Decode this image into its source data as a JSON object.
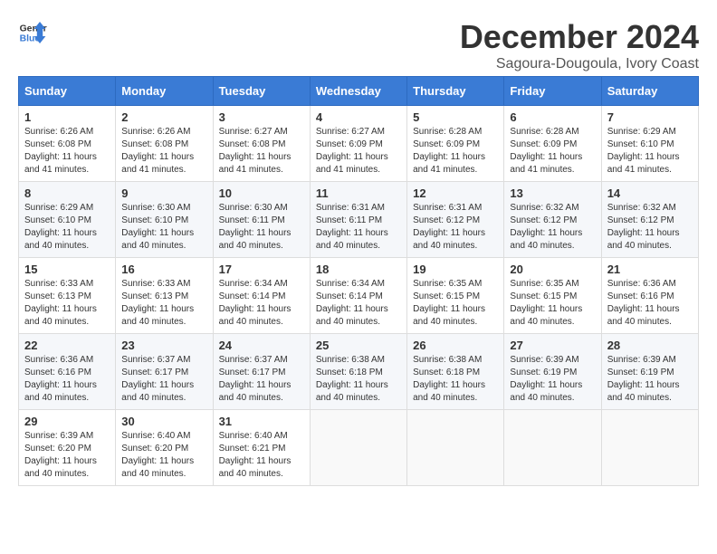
{
  "logo": {
    "line1": "General",
    "line2": "Blue"
  },
  "title": "December 2024",
  "subtitle": "Sagoura-Dougoula, Ivory Coast",
  "days": [
    "Sunday",
    "Monday",
    "Tuesday",
    "Wednesday",
    "Thursday",
    "Friday",
    "Saturday"
  ],
  "weeks": [
    [
      {
        "day": "1",
        "sunrise": "6:26 AM",
        "sunset": "6:08 PM",
        "daylight": "11 hours and 41 minutes."
      },
      {
        "day": "2",
        "sunrise": "6:26 AM",
        "sunset": "6:08 PM",
        "daylight": "11 hours and 41 minutes."
      },
      {
        "day": "3",
        "sunrise": "6:27 AM",
        "sunset": "6:08 PM",
        "daylight": "11 hours and 41 minutes."
      },
      {
        "day": "4",
        "sunrise": "6:27 AM",
        "sunset": "6:09 PM",
        "daylight": "11 hours and 41 minutes."
      },
      {
        "day": "5",
        "sunrise": "6:28 AM",
        "sunset": "6:09 PM",
        "daylight": "11 hours and 41 minutes."
      },
      {
        "day": "6",
        "sunrise": "6:28 AM",
        "sunset": "6:09 PM",
        "daylight": "11 hours and 41 minutes."
      },
      {
        "day": "7",
        "sunrise": "6:29 AM",
        "sunset": "6:10 PM",
        "daylight": "11 hours and 41 minutes."
      }
    ],
    [
      {
        "day": "8",
        "sunrise": "6:29 AM",
        "sunset": "6:10 PM",
        "daylight": "11 hours and 40 minutes."
      },
      {
        "day": "9",
        "sunrise": "6:30 AM",
        "sunset": "6:10 PM",
        "daylight": "11 hours and 40 minutes."
      },
      {
        "day": "10",
        "sunrise": "6:30 AM",
        "sunset": "6:11 PM",
        "daylight": "11 hours and 40 minutes."
      },
      {
        "day": "11",
        "sunrise": "6:31 AM",
        "sunset": "6:11 PM",
        "daylight": "11 hours and 40 minutes."
      },
      {
        "day": "12",
        "sunrise": "6:31 AM",
        "sunset": "6:12 PM",
        "daylight": "11 hours and 40 minutes."
      },
      {
        "day": "13",
        "sunrise": "6:32 AM",
        "sunset": "6:12 PM",
        "daylight": "11 hours and 40 minutes."
      },
      {
        "day": "14",
        "sunrise": "6:32 AM",
        "sunset": "6:12 PM",
        "daylight": "11 hours and 40 minutes."
      }
    ],
    [
      {
        "day": "15",
        "sunrise": "6:33 AM",
        "sunset": "6:13 PM",
        "daylight": "11 hours and 40 minutes."
      },
      {
        "day": "16",
        "sunrise": "6:33 AM",
        "sunset": "6:13 PM",
        "daylight": "11 hours and 40 minutes."
      },
      {
        "day": "17",
        "sunrise": "6:34 AM",
        "sunset": "6:14 PM",
        "daylight": "11 hours and 40 minutes."
      },
      {
        "day": "18",
        "sunrise": "6:34 AM",
        "sunset": "6:14 PM",
        "daylight": "11 hours and 40 minutes."
      },
      {
        "day": "19",
        "sunrise": "6:35 AM",
        "sunset": "6:15 PM",
        "daylight": "11 hours and 40 minutes."
      },
      {
        "day": "20",
        "sunrise": "6:35 AM",
        "sunset": "6:15 PM",
        "daylight": "11 hours and 40 minutes."
      },
      {
        "day": "21",
        "sunrise": "6:36 AM",
        "sunset": "6:16 PM",
        "daylight": "11 hours and 40 minutes."
      }
    ],
    [
      {
        "day": "22",
        "sunrise": "6:36 AM",
        "sunset": "6:16 PM",
        "daylight": "11 hours and 40 minutes."
      },
      {
        "day": "23",
        "sunrise": "6:37 AM",
        "sunset": "6:17 PM",
        "daylight": "11 hours and 40 minutes."
      },
      {
        "day": "24",
        "sunrise": "6:37 AM",
        "sunset": "6:17 PM",
        "daylight": "11 hours and 40 minutes."
      },
      {
        "day": "25",
        "sunrise": "6:38 AM",
        "sunset": "6:18 PM",
        "daylight": "11 hours and 40 minutes."
      },
      {
        "day": "26",
        "sunrise": "6:38 AM",
        "sunset": "6:18 PM",
        "daylight": "11 hours and 40 minutes."
      },
      {
        "day": "27",
        "sunrise": "6:39 AM",
        "sunset": "6:19 PM",
        "daylight": "11 hours and 40 minutes."
      },
      {
        "day": "28",
        "sunrise": "6:39 AM",
        "sunset": "6:19 PM",
        "daylight": "11 hours and 40 minutes."
      }
    ],
    [
      {
        "day": "29",
        "sunrise": "6:39 AM",
        "sunset": "6:20 PM",
        "daylight": "11 hours and 40 minutes."
      },
      {
        "day": "30",
        "sunrise": "6:40 AM",
        "sunset": "6:20 PM",
        "daylight": "11 hours and 40 minutes."
      },
      {
        "day": "31",
        "sunrise": "6:40 AM",
        "sunset": "6:21 PM",
        "daylight": "11 hours and 40 minutes."
      },
      null,
      null,
      null,
      null
    ]
  ]
}
